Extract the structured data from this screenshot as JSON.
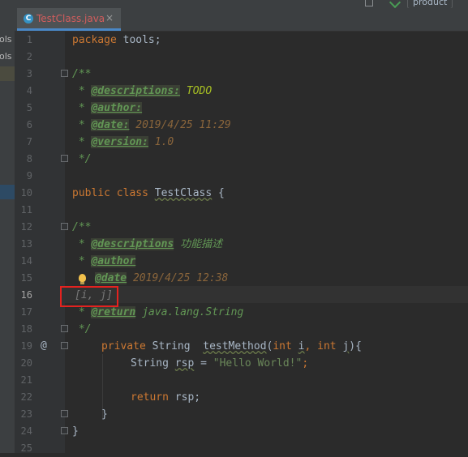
{
  "tab": {
    "filename": "TestClass.java",
    "close": "×",
    "icon_letter": "C"
  },
  "toolbar": {
    "product_label": "product"
  },
  "project_panel": {
    "item1": "ols",
    "item2": "ols"
  },
  "gutter": {
    "override_marker": "@",
    "lines": [
      "1",
      "2",
      "3",
      "4",
      "5",
      "6",
      "7",
      "8",
      "9",
      "10",
      "11",
      "12",
      "13",
      "14",
      "15",
      "16",
      "17",
      "18",
      "19",
      "20",
      "21",
      "22",
      "23",
      "24",
      "25"
    ]
  },
  "code": {
    "l1": {
      "kw": "package",
      "rest": " tools;"
    },
    "l3": "/**",
    "l4": {
      "pre": " * ",
      "tag": "@descriptions:",
      "sp": " ",
      "val": "TODO"
    },
    "l5": {
      "pre": " * ",
      "tag": "@author:"
    },
    "l6": {
      "pre": " * ",
      "tag": "@date:",
      "val": " 2019/4/25 11:29"
    },
    "l7": {
      "pre": " * ",
      "tag": "@version:",
      "val": " 1.0"
    },
    "l8": " */",
    "l10": {
      "kw1": "public",
      "kw2": "class",
      "name": "TestClass",
      "rest": " {"
    },
    "l12": "/**",
    "l13": {
      "pre": " * ",
      "tag": "@descriptions",
      "sp": " ",
      "val": "功能描述"
    },
    "l14": {
      "pre": " * ",
      "tag": "@author"
    },
    "l15": {
      "tag": "@date",
      "val": " 2019/4/25 12:38"
    },
    "l16": "[i, j]",
    "l17": {
      "pre": " * ",
      "tag": "@return",
      "val": " java.lang.String"
    },
    "l18": " */",
    "l19": {
      "kw": "private",
      "type": " String  ",
      "method": "testMethod",
      "p1": "(",
      "kw_int1": "int",
      "sp1": " ",
      "pi": "i",
      "comma": ", ",
      "kw_int2": "int",
      "sp2": " ",
      "pj": "j",
      "end": "){"
    },
    "l20": {
      "type": "String ",
      "var": "rsp",
      "eq": " = ",
      "str": "\"Hello World!\"",
      "semi": ";"
    },
    "l22": {
      "kw": "return",
      "rest": " rsp;"
    },
    "l23": "}",
    "l24": "}"
  },
  "colors": {
    "background": "#2b2b2b",
    "keyword": "#cc7832",
    "doc_comment": "#629755",
    "string": "#6a8759",
    "highlight_box": "#e5221f",
    "tab_accent": "#4a88c7"
  }
}
